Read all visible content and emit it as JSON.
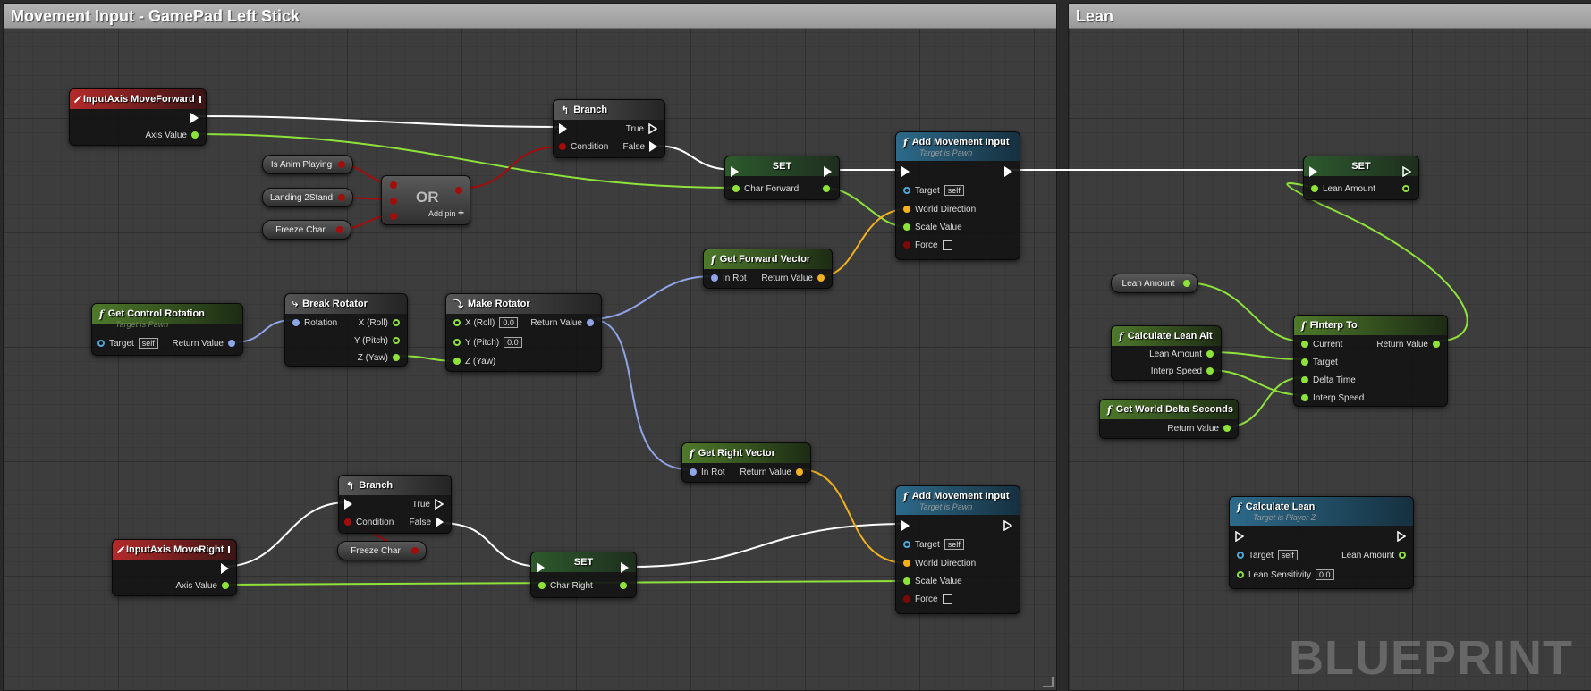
{
  "comments": {
    "movement": "Movement Input - GamePad Left Stick",
    "lean": "Lean"
  },
  "watermark": "BLUEPRINT",
  "colors": {
    "exec": "#ffffff",
    "float": "#8ee23a",
    "bool": "#a50c0c",
    "struct_rotator": "#90a4e8",
    "vector": "#f2b11e",
    "object": "#4fa7d8"
  },
  "nodes": {
    "move_forward": {
      "title": "InputAxis MoveForward",
      "axis": "Axis Value"
    },
    "branch1": {
      "title": "Branch",
      "condition": "Condition",
      "true": "True",
      "false": "False"
    },
    "is_anim": "Is Anim Playing",
    "landing": "Landing 2Stand",
    "freeze1": "Freeze Char",
    "or": {
      "title": "OR",
      "add_pin": "Add pin"
    },
    "set1": {
      "title": "SET",
      "var": "Char Forward"
    },
    "add_move1": {
      "title": "Add Movement Input",
      "sub": "Target is Pawn",
      "target": "Target",
      "self": "self",
      "world_dir": "World Direction",
      "scale": "Scale Value",
      "force": "Force"
    },
    "get_fwd": {
      "title": "Get Forward Vector",
      "in": "In Rot",
      "ret": "Return Value"
    },
    "get_ctrl": {
      "title": "Get Control Rotation",
      "sub": "Target is Pawn",
      "target": "Target",
      "self": "self",
      "ret": "Return Value"
    },
    "break_rot": {
      "title": "Break Rotator",
      "rotation": "Rotation",
      "x": "X (Roll)",
      "y": "Y (Pitch)",
      "z": "Z (Yaw)"
    },
    "make_rot": {
      "title": "Make Rotator",
      "x": "X (Roll)",
      "xv": "0.0",
      "y": "Y (Pitch)",
      "yv": "0.0",
      "z": "Z (Yaw)",
      "ret": "Return Value"
    },
    "get_right": {
      "title": "Get Right Vector",
      "in": "In Rot",
      "ret": "Return Value"
    },
    "branch2": {
      "title": "Branch",
      "condition": "Condition",
      "true": "True",
      "false": "False"
    },
    "freeze2": "Freeze Char",
    "move_right": {
      "title": "InputAxis MoveRight",
      "axis": "Axis Value"
    },
    "set2": {
      "title": "SET",
      "var": "Char Right"
    },
    "add_move2": {
      "title": "Add Movement Input",
      "sub": "Target is Pawn",
      "target": "Target",
      "self": "self",
      "world_dir": "World Direction",
      "scale": "Scale Value",
      "force": "Force"
    },
    "set_lean": {
      "title": "SET",
      "var": "Lean Amount"
    },
    "lean_amount_var": "Lean Amount",
    "calc_lean_alt": {
      "title": "Calculate Lean Alt",
      "lean": "Lean Amount",
      "interp": "Interp Speed"
    },
    "finterp": {
      "title": "FInterp To",
      "current": "Current",
      "target": "Target",
      "delta": "Delta Time",
      "interp": "Interp Speed",
      "ret": "Return Value"
    },
    "world_delta": {
      "title": "Get World Delta Seconds",
      "ret": "Return Value"
    },
    "calc_lean": {
      "title": "Calculate Lean",
      "sub": "Target is Player Z",
      "target": "Target",
      "self": "self",
      "lean": "Lean Amount",
      "sens": "Lean Sensitivity",
      "sensv": "0.0"
    }
  }
}
